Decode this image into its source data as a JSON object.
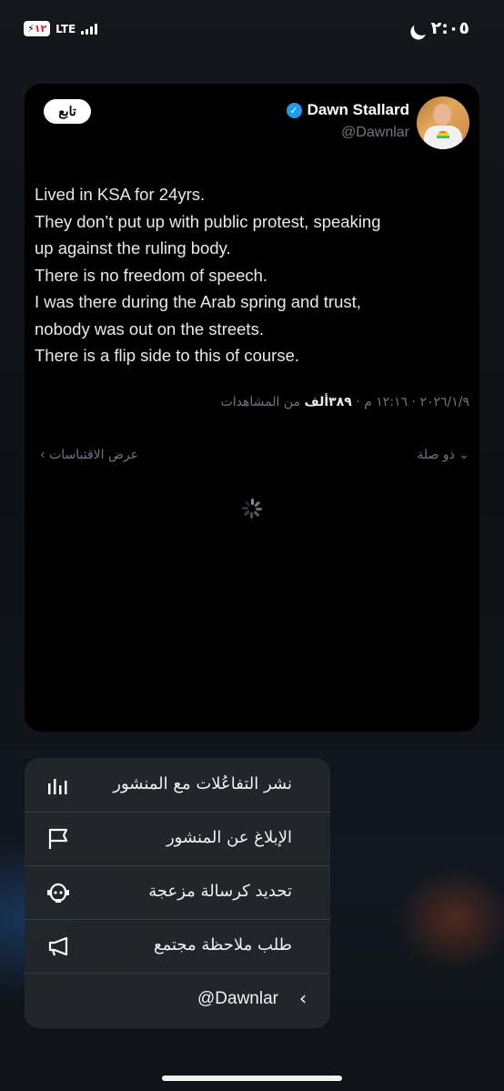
{
  "status_bar": {
    "time": "٢:٠٥",
    "battery": "١٢",
    "network": "LTE"
  },
  "tweet": {
    "follow_label": "تابع",
    "display_name": "Dawn Stallard",
    "handle": "@Dawnlar",
    "lines": [
      "Lived in KSA for 24yrs.",
      "They don’t put up with public protest, speaking",
      "up against the ruling body.",
      "There is no freedom of speech.",
      "I was there during the Arab spring and trust,",
      "nobody was out on the streets.",
      "There is a flip side to this of course."
    ],
    "meta_prefix": "٢٠٢٦/١/٩ · ١٢:١٦ م · ",
    "views_count": "٣٨٩ألف",
    "views_label": " من المشاهدات",
    "related_label": "ذو صلة",
    "quotes_label": "عرض الاقتباسات"
  },
  "menu": {
    "items": [
      {
        "label": "نشر التفاعُلات مع المنشور",
        "icon": "analytics-icon"
      },
      {
        "label": "الإبلاغ عن المنشور",
        "icon": "flag-icon"
      },
      {
        "label": "تحديد كرسالة مزعجة",
        "icon": "spam-robot-icon"
      },
      {
        "label": "طلب ملاحظة مجتمع",
        "icon": "megaphone-icon"
      },
      {
        "label": "@Dawnlar",
        "icon": "chevron-left-icon"
      }
    ]
  }
}
